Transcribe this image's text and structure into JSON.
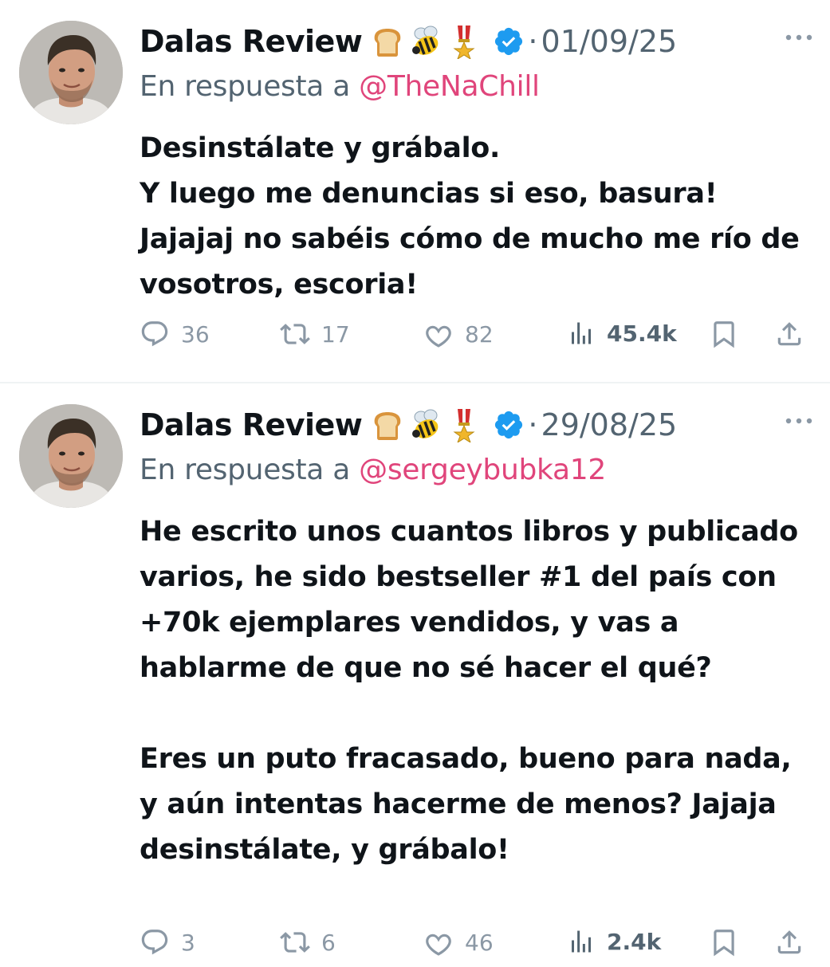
{
  "tweets": [
    {
      "author": "Dalas Review",
      "emojis": [
        "bread-emoji",
        "bee-emoji",
        "military-medal-emoji"
      ],
      "date_sep": "·",
      "date": "01/09/25",
      "reply_prefix": "En respuesta a",
      "reply_handle": "@TheNaChill",
      "text": "Desinstálate y grábalo.\nY luego me denuncias si eso, basura!\nJajajaj no sabéis cómo de mucho me río de vosotros, escoria!",
      "stats": {
        "replies": "36",
        "retweets": "17",
        "likes": "82",
        "views": "45.4k"
      }
    },
    {
      "author": "Dalas Review",
      "emojis": [
        "bread-emoji",
        "bee-emoji",
        "military-medal-emoji"
      ],
      "date_sep": "·",
      "date": "29/08/25",
      "reply_prefix": "En respuesta a",
      "reply_handle": "@sergeybubka12",
      "text": "He escrito unos cuantos libros y publicado varios, he sido bestseller #1 del país con +70k ejemplares vendidos, y vas a hablarme de que no sé hacer el qué?\n\nEres un puto fracasado, bueno para nada, y aún intentas hacerme de menos? Jajaja desinstálate, y grábalo!",
      "stats": {
        "replies": "3",
        "retweets": "6",
        "likes": "46",
        "views": "2.4k"
      }
    }
  ],
  "colors": {
    "verified": "#1d9bf0",
    "handle": "#e0457b",
    "secondary_text": "#536471",
    "icon_gray": "#8b98a5"
  }
}
